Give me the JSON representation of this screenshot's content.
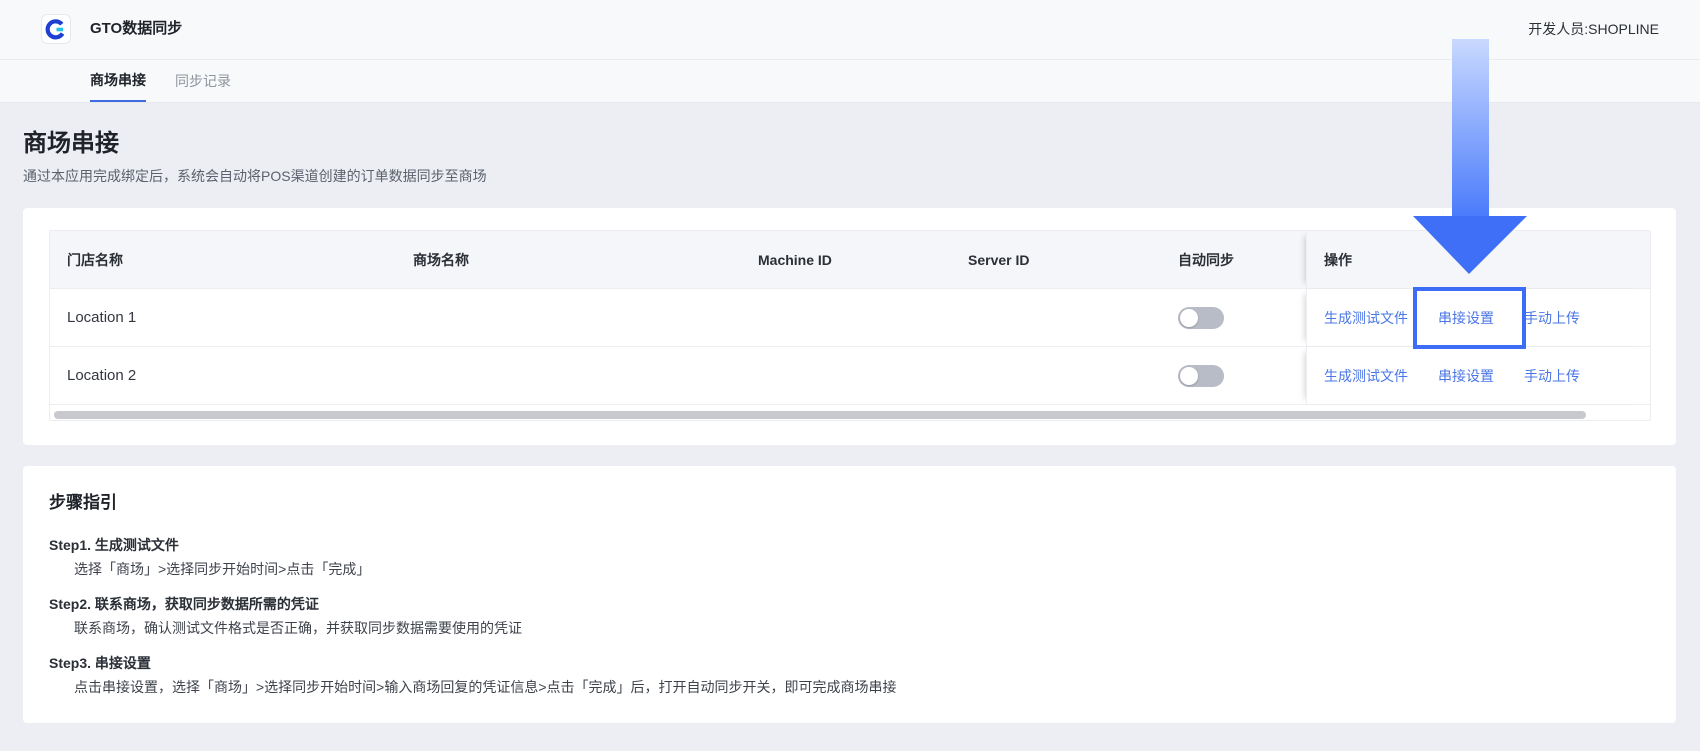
{
  "app": {
    "title": "GTO数据同步",
    "developer_label": "开发人员:SHOPLINE"
  },
  "tabs": [
    {
      "label": "商场串接",
      "active": true
    },
    {
      "label": "同步记录",
      "active": false
    }
  ],
  "page": {
    "title": "商场串接",
    "subtitle": "通过本应用完成绑定后，系统会自动将POS渠道创建的订单数据同步至商场"
  },
  "table": {
    "columns": [
      "门店名称",
      "商场名称",
      "Machine ID",
      "Server ID",
      "自动同步",
      "操作"
    ],
    "rows": [
      {
        "store": "Location 1",
        "auto_sync": false,
        "actions": [
          "生成测试文件",
          "串接设置",
          "手动上传"
        ]
      },
      {
        "store": "Location 2",
        "auto_sync": false,
        "actions": [
          "生成测试文件",
          "串接设置",
          "手动上传"
        ]
      }
    ]
  },
  "guide": {
    "title": "步骤指引",
    "steps": [
      {
        "title": "Step1. 生成测试文件",
        "desc": "选择「商场」>选择同步开始时间>点击「完成」"
      },
      {
        "title": "Step2. 联系商场，获取同步数据所需的凭证",
        "desc": "联系商场，确认测试文件格式是否正确，并获取同步数据需要使用的凭证"
      },
      {
        "title": "Step3. 串接设置",
        "desc": "点击串接设置，选择「商场」>选择同步开始时间>输入商场回复的凭证信息>点击「完成」后，打开自动同步开关，即可完成商场串接"
      }
    ]
  },
  "icons": {
    "logo": "gto-logo-icon",
    "annotation_arrow": "down-arrow-icon"
  },
  "colors": {
    "accent": "#3d6cf6",
    "link": "#4a76e6",
    "page_bg": "#eceef3",
    "toggle_off": "#b8bcc7"
  }
}
